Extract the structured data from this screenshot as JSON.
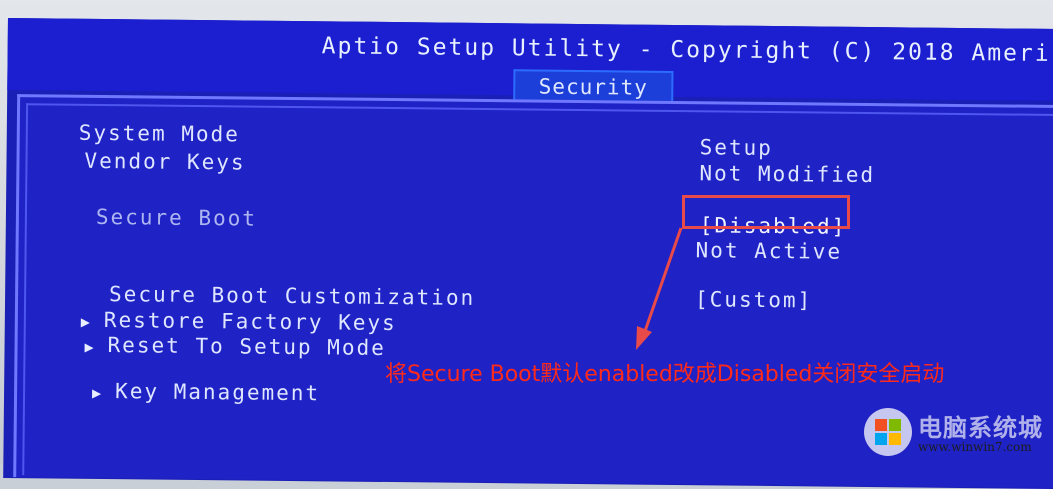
{
  "header": {
    "title": "Aptio Setup Utility - Copyright (C) 2018 Ameri",
    "active_tab": "Security"
  },
  "settings": {
    "system_mode": {
      "label": "System Mode",
      "value": "Setup"
    },
    "vendor_keys": {
      "label": "Vendor Keys",
      "value": "Not Modified"
    },
    "secure_boot": {
      "label": "Secure Boot",
      "value": "[Disabled]",
      "status": "Not Active"
    },
    "secure_boot_customization": {
      "label": "Secure Boot Customization",
      "value": "[Custom]"
    },
    "submenus": [
      {
        "label": "Restore Factory Keys"
      },
      {
        "label": "Reset To Setup Mode"
      },
      {
        "label": "Key Management"
      }
    ]
  },
  "annotation": {
    "text": "将Secure Boot默认enabled改成Disabled关闭安全启动",
    "color": "#ff2a1a"
  },
  "watermark": {
    "text": "电脑系统城",
    "url": "www.winwin7.com"
  },
  "colors": {
    "bios_blue": "#1f22c4",
    "text_light": "#dfe6ff",
    "highlight_red": "#e84a4a"
  }
}
